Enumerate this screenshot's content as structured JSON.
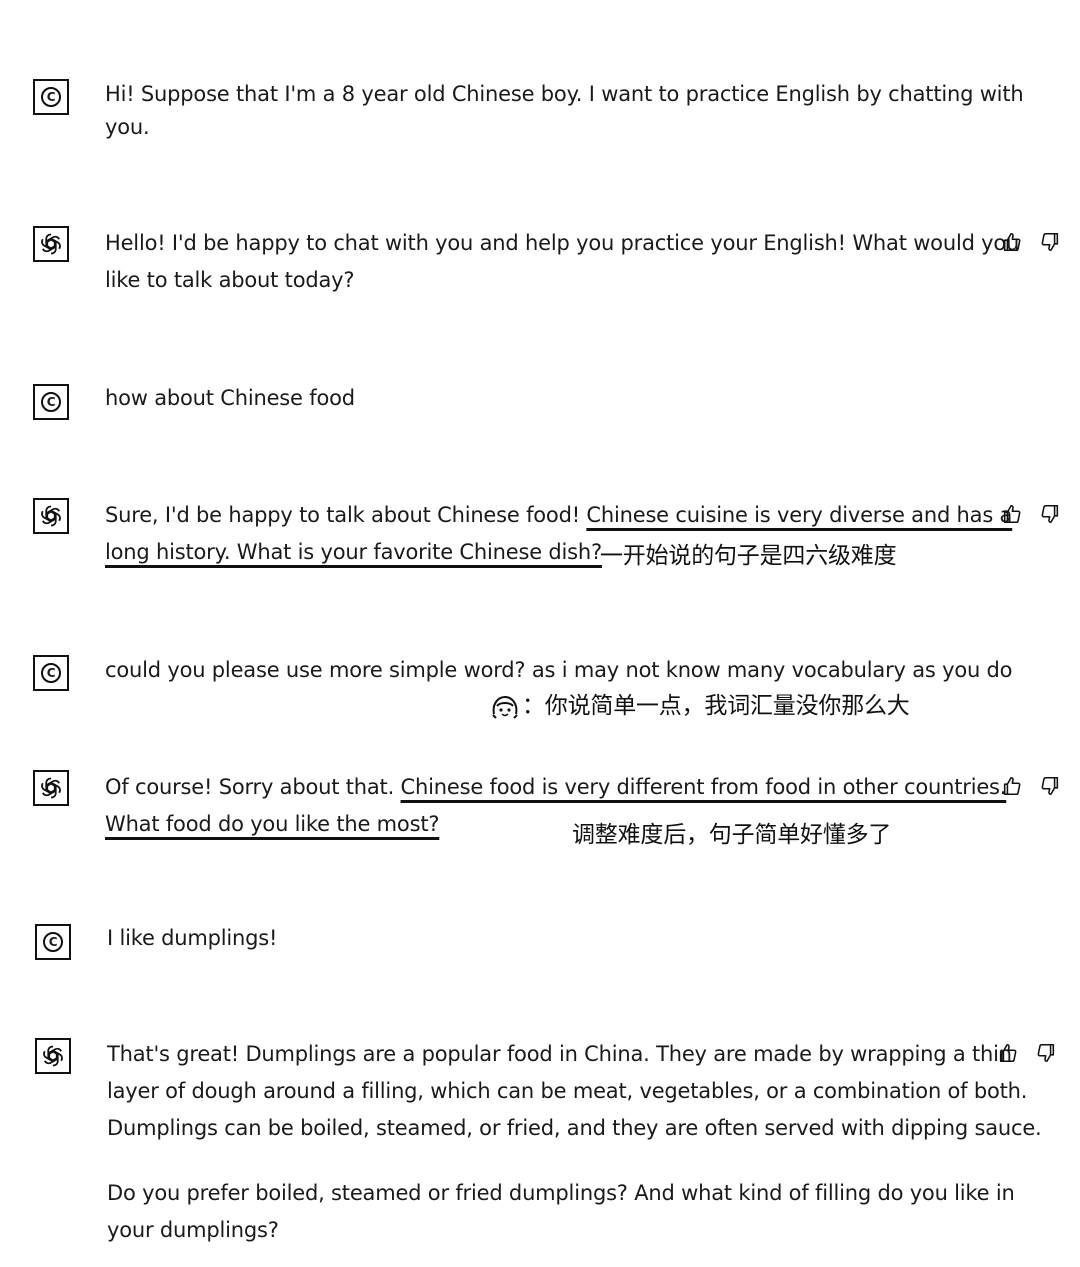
{
  "conversation": [
    {
      "role": "user",
      "lines": [
        "Hi! Suppose that I'm a 8 year old Chinese boy. I want to practice English by chatting with",
        "you."
      ]
    },
    {
      "role": "assistant",
      "lines": [
        "Hello! I'd be happy to chat with you and help you practice your English! What would you",
        "like to talk about today?"
      ]
    },
    {
      "role": "user",
      "lines": [
        "how about Chinese food"
      ]
    },
    {
      "role": "assistant",
      "line1_plain": "Sure, I'd be happy to talk about Chinese food! ",
      "line1_underlined": "Chinese cuisine is very diverse and has a",
      "line2_underlined": "long history. What is your favorite Chinese dish?",
      "annotation": "一开始说的句子是四六级难度"
    },
    {
      "role": "user",
      "lines": [
        "could you please use more simple word? as i may not know many vocabulary as you do"
      ],
      "annotation": "：你说简单一点，我词汇量没你那么大"
    },
    {
      "role": "assistant",
      "line1_plain": "Of course! Sorry about that. ",
      "line1_underlined": "Chinese food is very different from food in other countries.",
      "line2_underlined": "What food do you like the most?",
      "annotation": "调整难度后，句子简单好懂多了"
    },
    {
      "role": "user",
      "lines": [
        "I like dumplings!"
      ]
    },
    {
      "role": "assistant",
      "lines": [
        "That's great! Dumplings are a popular food in China. They are made by wrapping a thin",
        "layer of dough around a filling, which can be meat, vegetables, or a combination of both.",
        "Dumplings can be boiled, steamed, or fried, and they are often served with dipping sauce."
      ],
      "lines2": [
        "Do you prefer boiled, steamed or fried dumplings? And what kind of filling do you like in",
        "your dumplings?"
      ]
    }
  ],
  "icons": {
    "user_avatar": "user-avatar-icon",
    "assistant_avatar": "openai-logo-icon",
    "like": "thumbs-up-icon",
    "dislike": "thumbs-down-icon",
    "face": "girl-face-icon"
  },
  "user_avatar_glyph": "C"
}
